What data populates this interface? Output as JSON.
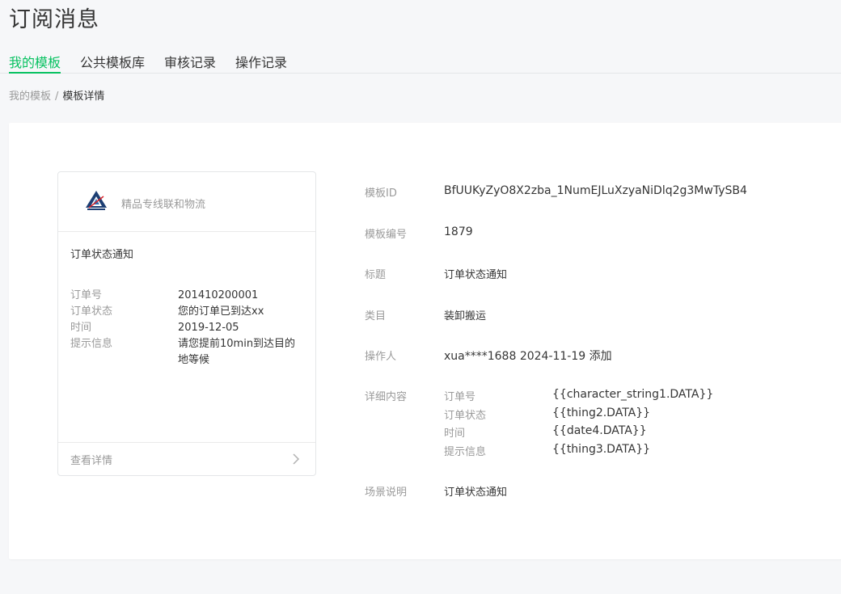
{
  "page": {
    "title": "订阅消息"
  },
  "tabs": [
    {
      "label": "我的模板",
      "active": true
    },
    {
      "label": "公共模板库",
      "active": false
    },
    {
      "label": "审核记录",
      "active": false
    },
    {
      "label": "操作记录",
      "active": false
    }
  ],
  "breadcrumb": {
    "parent": "我的模板",
    "separator": "/",
    "current": "模板详情"
  },
  "preview_card": {
    "logo_icon": "company-logo",
    "brand_name": "精品专线联和物流",
    "title": "订单状态通知",
    "fields": [
      {
        "key": "订单号",
        "value": "201410200001"
      },
      {
        "key": "订单状态",
        "value": "您的订单已到达xx"
      },
      {
        "key": "时间",
        "value": "2019-12-05"
      },
      {
        "key": "提示信息",
        "value": "请您提前10min到达目的地等候"
      }
    ],
    "footer_label": "查看详情",
    "footer_icon": "chevron-right-icon"
  },
  "details": {
    "template_id": {
      "label": "模板ID",
      "value": "BfUUKyZyO8X2zba_1NumEJLuXzyaNiDlq2g3MwTySB4"
    },
    "template_no": {
      "label": "模板编号",
      "value": "1879"
    },
    "title": {
      "label": "标题",
      "value": "订单状态通知"
    },
    "category": {
      "label": "类目",
      "value": "装卸搬运"
    },
    "operator": {
      "label": "操作人",
      "value": "xua****1688 2024-11-19 添加"
    },
    "content": {
      "label": "详细内容",
      "items": [
        {
          "key": "订单号",
          "value": "{{character_string1.DATA}}"
        },
        {
          "key": "订单状态",
          "value": "{{thing2.DATA}}"
        },
        {
          "key": "时间",
          "value": "{{date4.DATA}}"
        },
        {
          "key": "提示信息",
          "value": "{{thing3.DATA}}"
        }
      ]
    },
    "scene": {
      "label": "场景说明",
      "value": "订单状态通知"
    }
  },
  "colors": {
    "accent": "#07c160",
    "muted": "#9a9a9a",
    "text": "#353535",
    "background": "#f6f7f9"
  }
}
